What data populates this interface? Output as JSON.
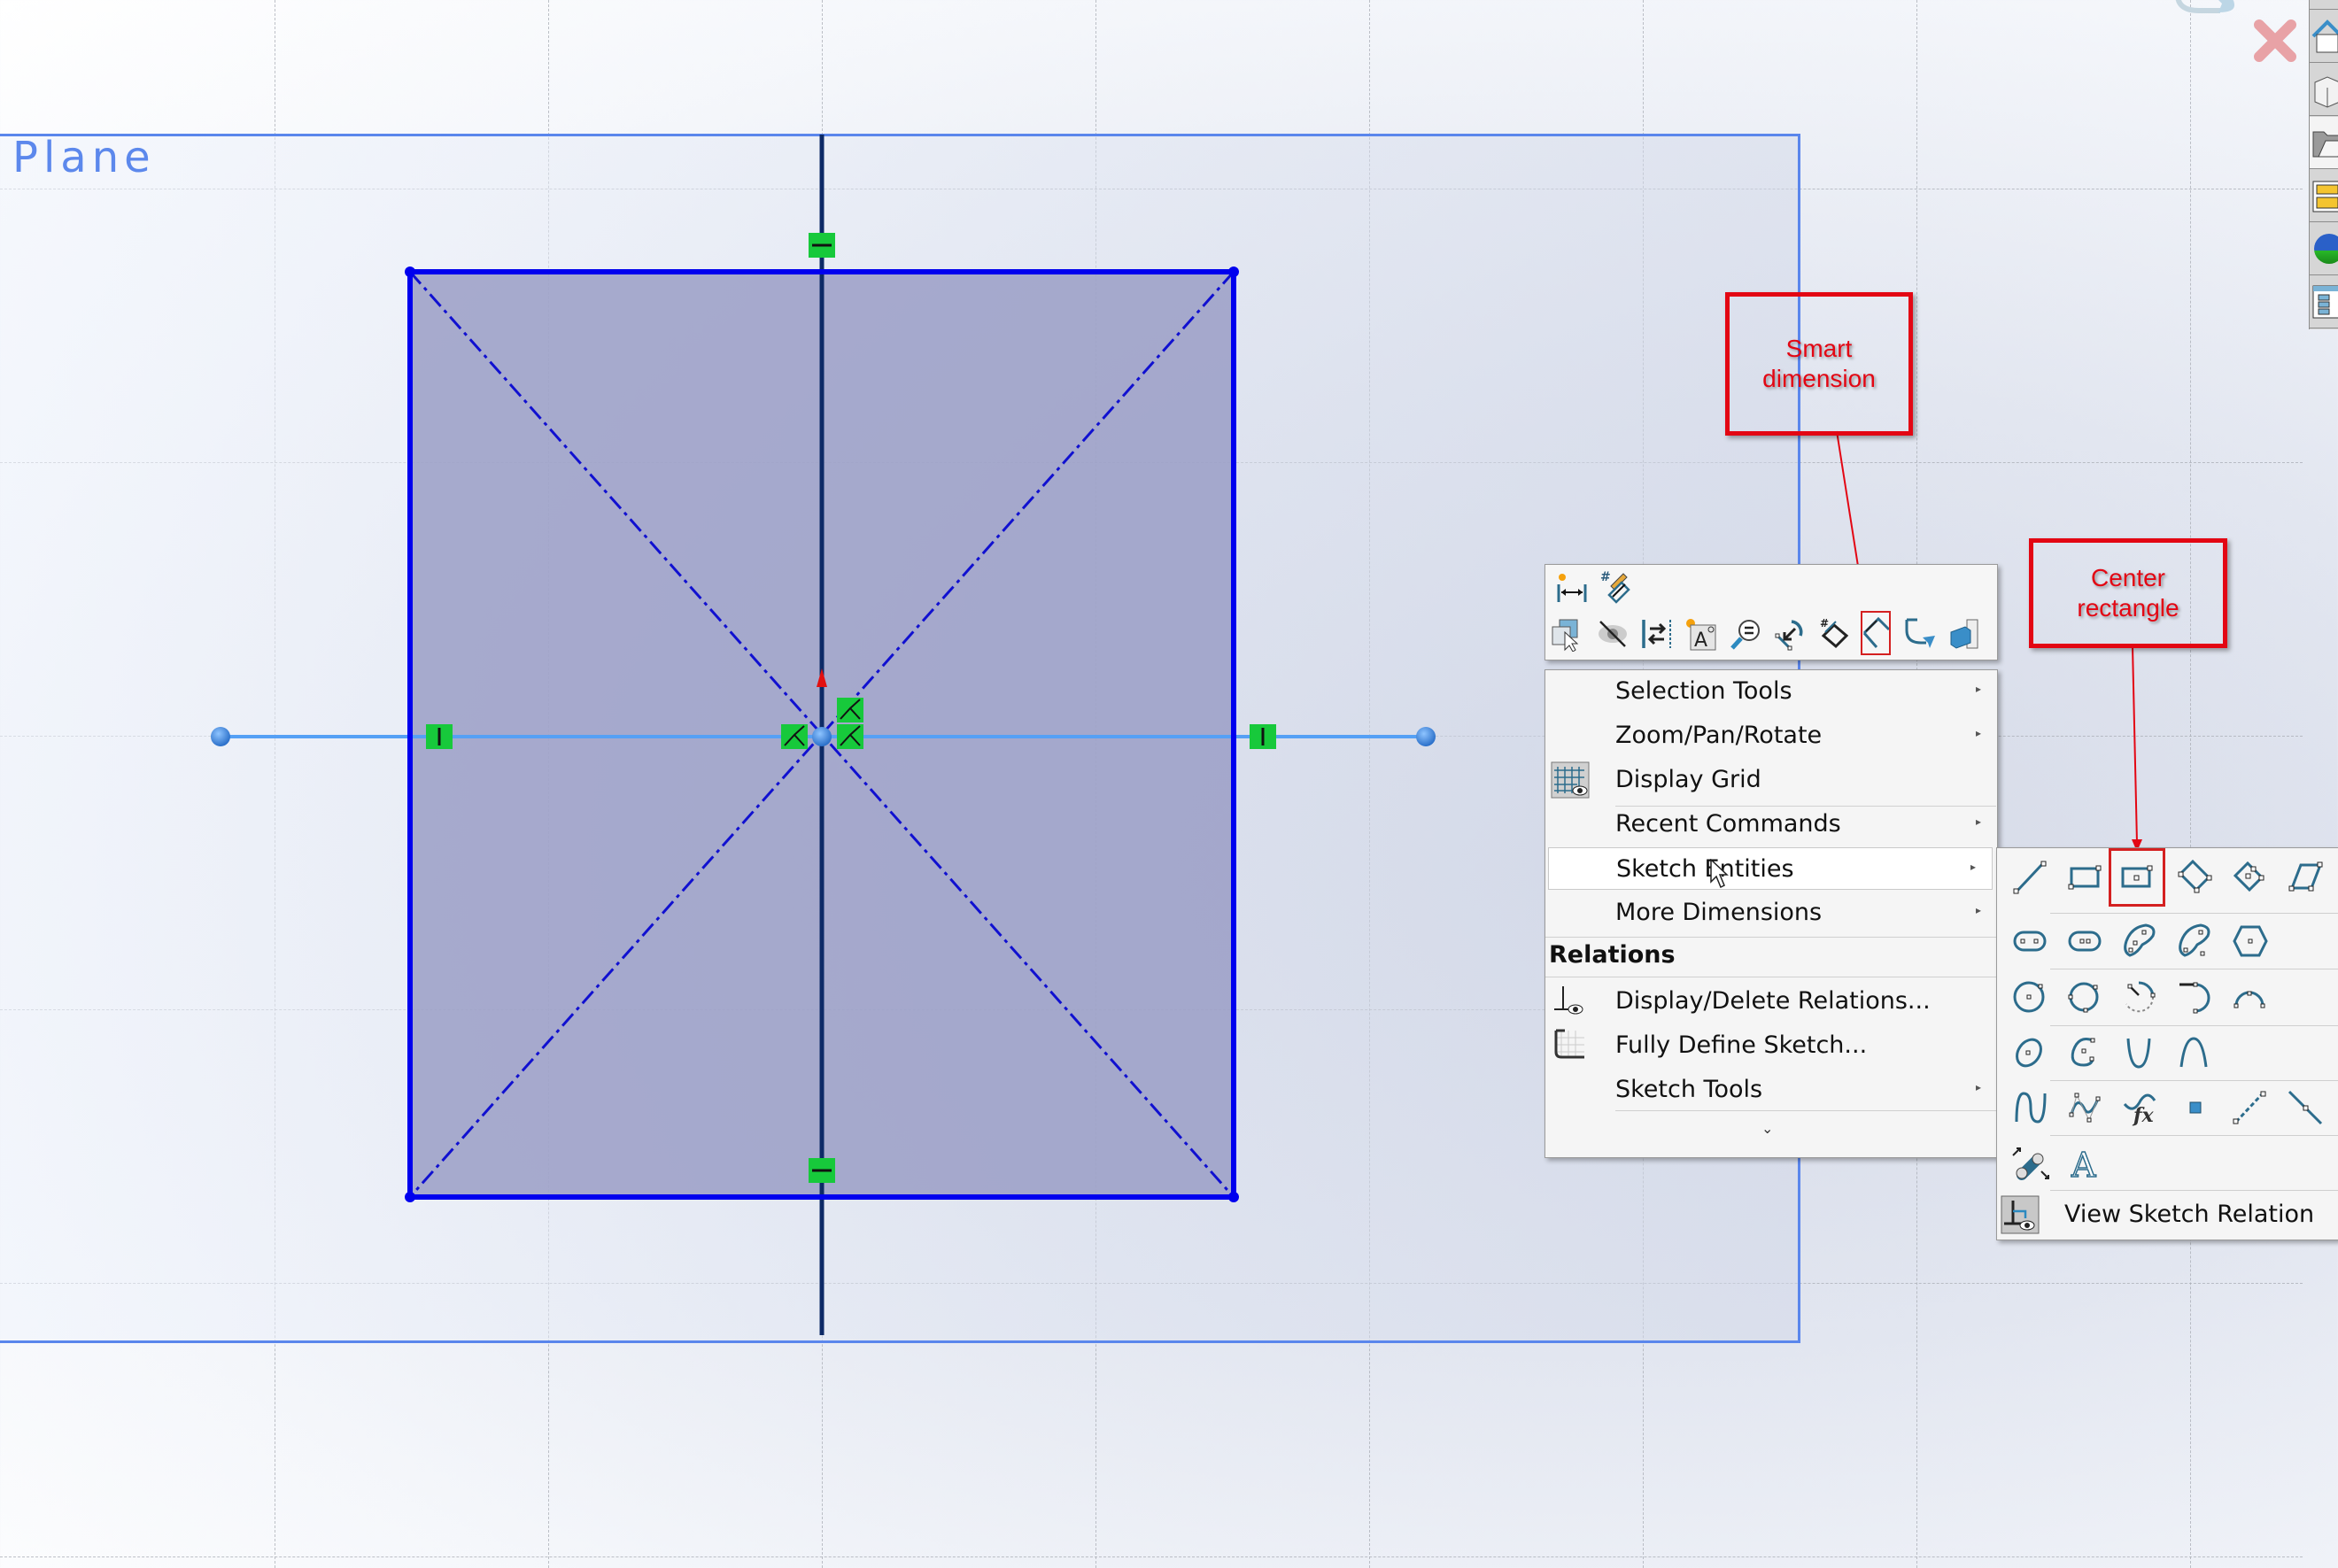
{
  "viewport": {
    "plane_label": "Plane",
    "confirm_corner": {
      "accept_icon": "sketch-exit-icon",
      "cancel_icon": "cancel-x-icon"
    }
  },
  "annotations": {
    "smart_dimension": "Smart dimension",
    "center_rectangle_line1": "Center",
    "center_rectangle_line2": "rectangle",
    "color": "#e30613"
  },
  "context_toolbar": {
    "row1": [
      {
        "name": "smart-dimension-icon",
        "tooltip": "Smart Dimension"
      },
      {
        "name": "edit-dimension-icon",
        "tooltip": "Instant 2D"
      }
    ],
    "row2": [
      {
        "name": "select-other-icon"
      },
      {
        "name": "hide-show-icon"
      },
      {
        "name": "mirror-entities-icon"
      },
      {
        "name": "annotation-note-icon"
      },
      {
        "name": "zoom-to-selection-icon"
      },
      {
        "name": "rotate-entities-icon"
      },
      {
        "name": "dimension-rectangle-icon"
      },
      {
        "name": "angular-dimension-icon",
        "highlighted": true
      },
      {
        "name": "fillet-arrow-icon"
      },
      {
        "name": "view-3d-icon"
      }
    ]
  },
  "context_menu": {
    "items": [
      {
        "label": "Selection Tools",
        "submenu": true
      },
      {
        "label": "Zoom/Pan/Rotate",
        "submenu": true
      },
      {
        "label": "Display Grid",
        "submenu": false,
        "icon": "display-grid-icon",
        "underline": "D"
      },
      {
        "label": "Recent Commands",
        "submenu": true,
        "underline": "R"
      },
      {
        "label": "Sketch Entities",
        "submenu": true,
        "hover": true
      },
      {
        "label": "More Dimensions",
        "submenu": true,
        "underline": "M"
      }
    ],
    "section_header": "Relations",
    "relations_items": [
      {
        "label": "Display/Delete Relations...",
        "icon": "display-relations-icon"
      },
      {
        "label": "Fully Define Sketch...",
        "icon": "fully-define-icon"
      },
      {
        "label": "Sketch Tools",
        "submenu": true
      }
    ],
    "expand_glyph": "⌄"
  },
  "sketch_entities_flyout": {
    "rows": [
      [
        "line",
        "corner-rectangle",
        "center-rectangle",
        "3-point-corner-rectangle",
        "3-point-center-rectangle",
        "parallelogram"
      ],
      [
        "straight-slot",
        "centerpoint-straight-slot",
        "3-point-arc-slot",
        "centerpoint-arc-slot",
        "polygon"
      ],
      [
        "circle",
        "perimeter-circle",
        "centerpoint-arc",
        "tangent-arc",
        "3-point-arc"
      ],
      [
        "ellipse",
        "partial-ellipse",
        "parabola",
        "conic"
      ],
      [
        "spline",
        "style-spline",
        "equation-driven-curve",
        "point",
        "centerline",
        "midpoint-line"
      ],
      [
        "belt-chain",
        "text"
      ]
    ],
    "highlighted": "center-rectangle",
    "footer_label": "View Sketch Relation"
  },
  "task_pane": {
    "tabs": [
      "solidworks-resources-icon",
      "design-library-icon",
      "file-explorer-icon",
      "view-palette-icon",
      "appearances-icon",
      "custom-properties-icon"
    ],
    "active_index": 2
  },
  "colors": {
    "sketch_line": "#0000ee",
    "construction_line": "#1010d0",
    "axis_line": "#0d2a66",
    "centerline": "#55a0f5",
    "relation_badge": "#17c93b",
    "plane_border": "#5a86ec",
    "rect_fill": "#9a9dc6"
  }
}
